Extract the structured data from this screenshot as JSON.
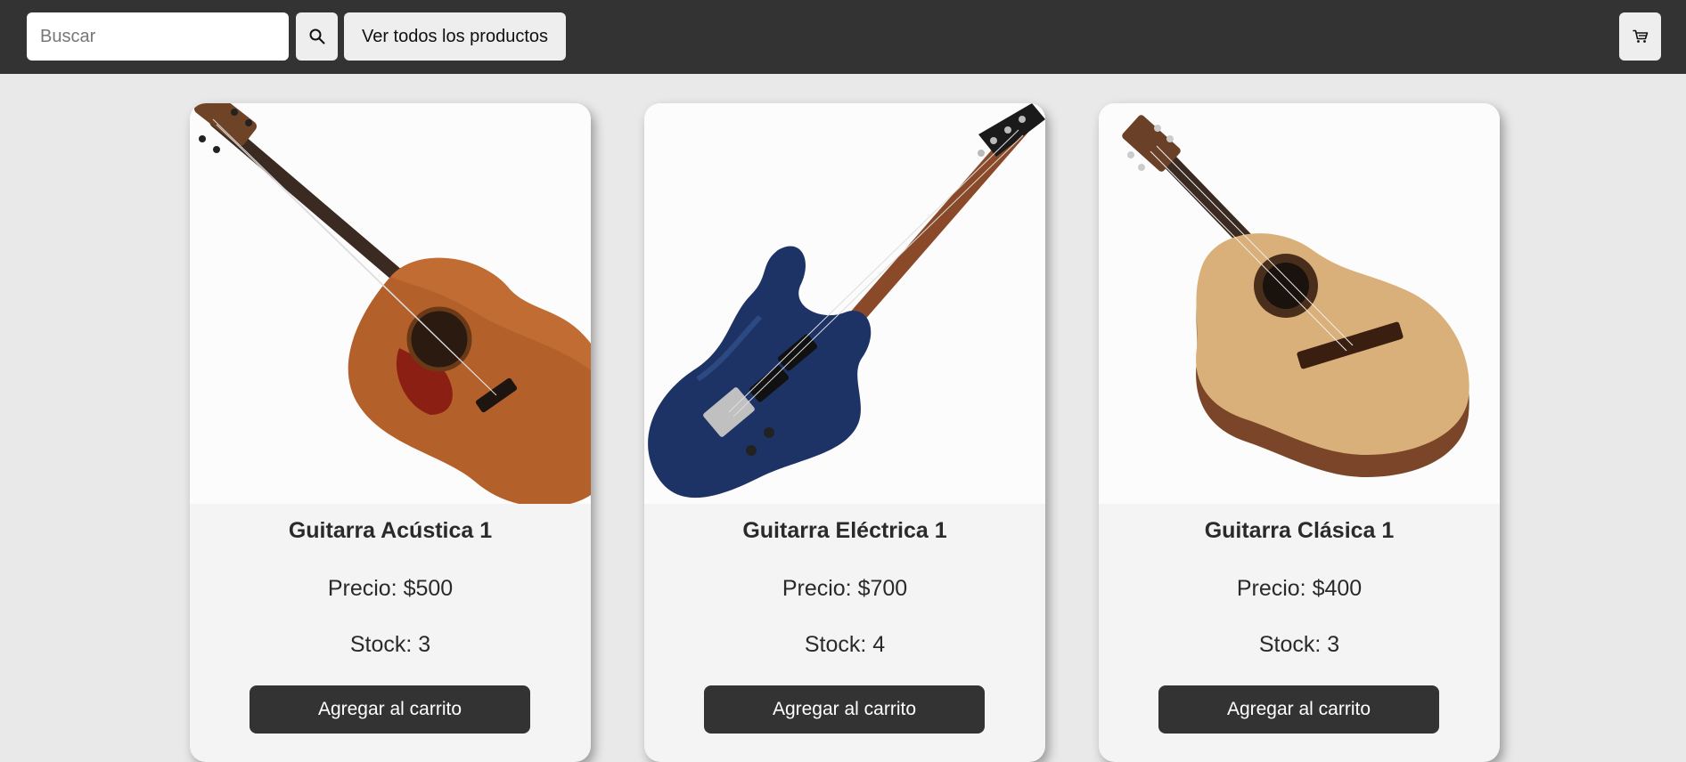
{
  "header": {
    "search": {
      "placeholder": "Buscar",
      "value": ""
    },
    "view_all_label": "Ver todos los productos",
    "search_icon": "search-icon",
    "cart_icon": "cart-icon"
  },
  "products": [
    {
      "name": "Guitarra Acústica 1",
      "price_label": "Precio: $500",
      "stock_label": "Stock: 3",
      "button": "Agregar al carrito",
      "image": "acoustic-guitar-image"
    },
    {
      "name": "Guitarra Eléctrica 1",
      "price_label": "Precio: $700",
      "stock_label": "Stock: 4",
      "button": "Agregar al carrito",
      "image": "electric-guitar-image"
    },
    {
      "name": "Guitarra Clásica 1",
      "price_label": "Precio: $400",
      "stock_label": "Stock: 3",
      "button": "Agregar al carrito",
      "image": "classical-guitar-image"
    }
  ],
  "colors": {
    "topbar": "#333333",
    "background": "#e9e9e9",
    "card": "#f4f4f4",
    "button_dark": "#333333"
  }
}
